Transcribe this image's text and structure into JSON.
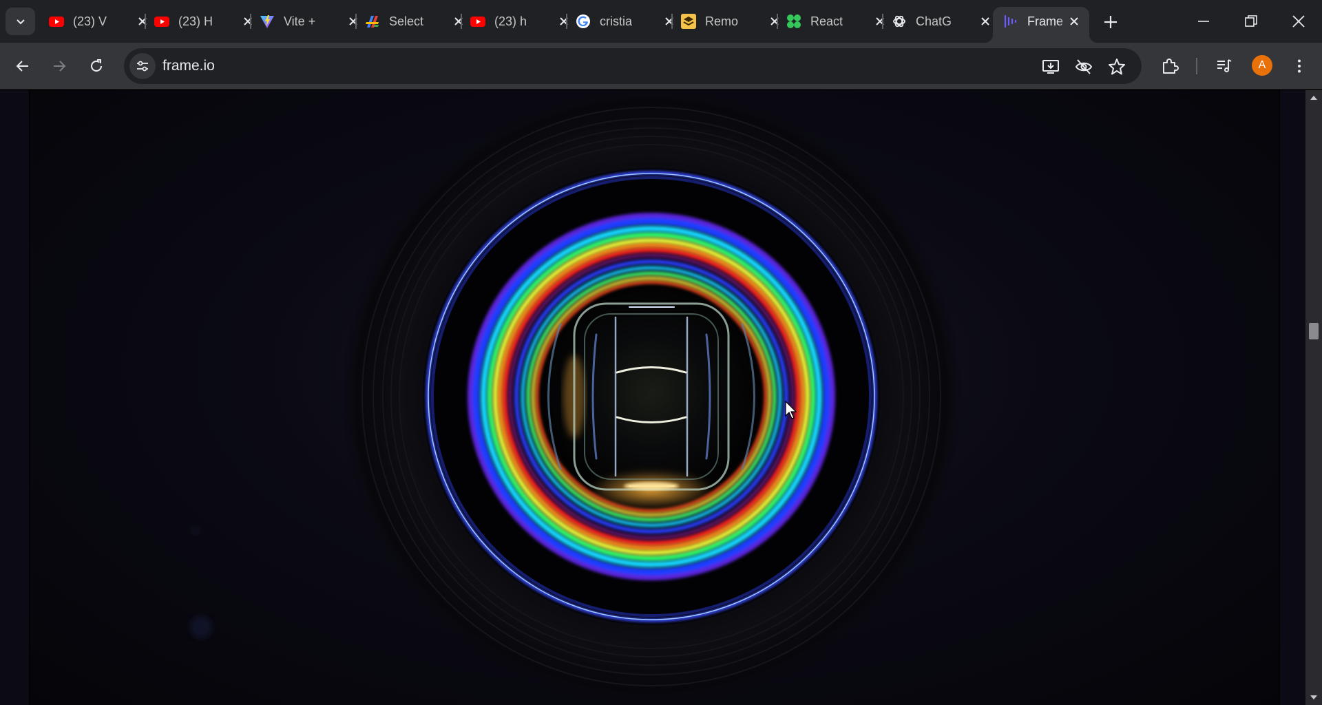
{
  "browser": {
    "tabs": [
      {
        "title": "(23) V",
        "favicon": "youtube-icon"
      },
      {
        "title": "(23) H",
        "favicon": "youtube-icon"
      },
      {
        "title": "Vite +",
        "favicon": "vite-icon"
      },
      {
        "title": "Select",
        "favicon": "select-app-icon"
      },
      {
        "title": "(23) h",
        "favicon": "youtube-icon"
      },
      {
        "title": "cristia",
        "favicon": "google-icon"
      },
      {
        "title": "Remo",
        "favicon": "remote-icon"
      },
      {
        "title": "React",
        "favicon": "react-flower-icon"
      },
      {
        "title": "ChatG",
        "favicon": "chatgpt-icon"
      },
      {
        "title": "Frame",
        "favicon": "frameio-icon",
        "active": true
      }
    ],
    "url": "frame.io",
    "profile_initial": "A",
    "accent_colors": {
      "youtube": "#ff0000",
      "profile": "#e8710a",
      "frameio": "#5b53ff"
    }
  },
  "page": {
    "hero_image": "camera-lens-rainbow-rings"
  }
}
